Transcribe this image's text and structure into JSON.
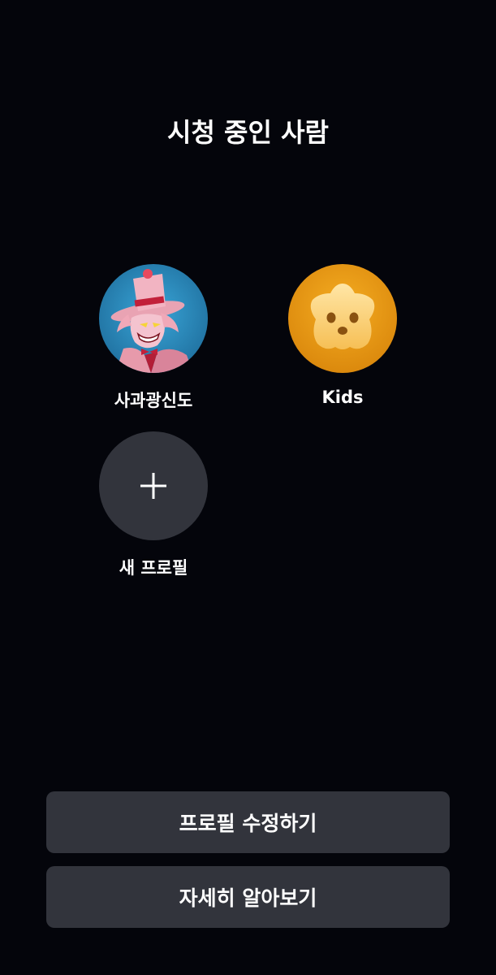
{
  "header": {
    "title": "시청 중인 사람"
  },
  "profiles": [
    {
      "name": "사과광신도",
      "avatar_icon": "character-avatar-icon"
    },
    {
      "name": "Kids",
      "avatar_icon": "kids-star-face-icon"
    }
  ],
  "add_profile": {
    "label": "새 프로필",
    "icon": "plus-icon"
  },
  "actions": {
    "edit_profiles_label": "프로필 수정하기",
    "learn_more_label": "자세히 알아보기"
  },
  "colors": {
    "background": "#04050b",
    "button_bg": "#32343c",
    "kids_orange": "#f0a21a",
    "avatar_blue": "#2a8fc4"
  }
}
